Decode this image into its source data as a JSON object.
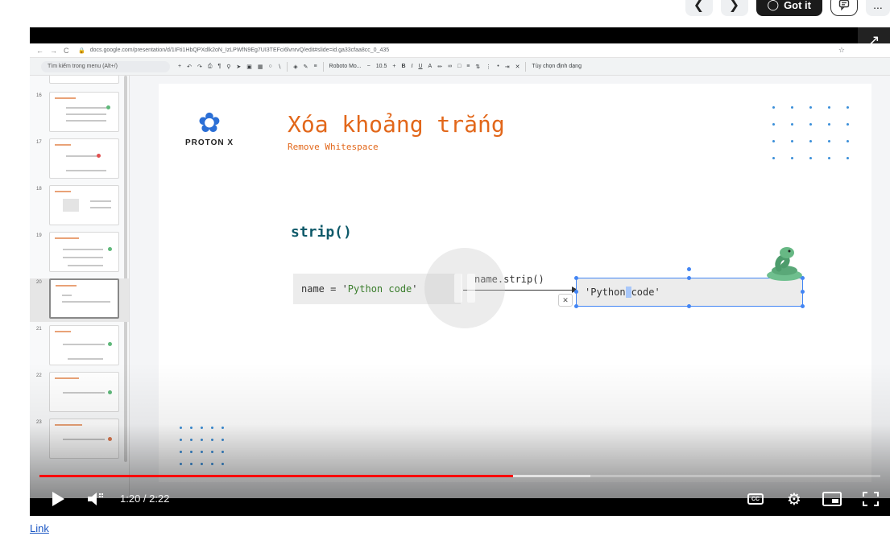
{
  "header": {
    "prev_icon": "chevron-left-icon",
    "next_icon": "chevron-right-icon",
    "got_it_label": "Got it",
    "got_it_icon": "lightbulb-icon",
    "feedback_icon": "feedback-icon",
    "more_label": "..."
  },
  "browser": {
    "url": "docs.google.com/presentation/d/1IFti1HbQPXdlk2oN_IzLPWfN9Eg7UI3TEFci6lvnrvQ/edit#slide=id.ga33cfaa8cc_0_435",
    "back": "←",
    "forward": "→",
    "reload": "C"
  },
  "toolbar": {
    "menu_search": "Tìm kiếm trong menu (Alt+/)",
    "font": "Roboto Mo...",
    "font_size": "10.5",
    "format_options": "Tùy chọn định dạng"
  },
  "thumbnails": [
    {
      "num": "16",
      "active": false
    },
    {
      "num": "17",
      "active": false
    },
    {
      "num": "18",
      "active": false
    },
    {
      "num": "19",
      "active": false
    },
    {
      "num": "20",
      "active": true
    },
    {
      "num": "21",
      "active": false
    },
    {
      "num": "22",
      "active": false
    },
    {
      "num": "23",
      "active": false
    }
  ],
  "slide": {
    "logo_text": "PROTON X",
    "title": "Xóa khoảng trắng",
    "subtitle": "Remove Whitespace",
    "function_name": "strip()",
    "code_left_prefix": "name = '",
    "code_left_value": "Python code",
    "code_left_suffix": "'",
    "method_call": "name.strip()",
    "result_before": "'Python",
    "result_after": "code'"
  },
  "player": {
    "current_time": "1:20",
    "duration": "2:22",
    "time_display": "1:20 / 2:22",
    "played_fraction": 0.563,
    "buffered_fraction": 0.655,
    "cc_label": "CC"
  },
  "footer": {
    "link_label": "Link"
  }
}
